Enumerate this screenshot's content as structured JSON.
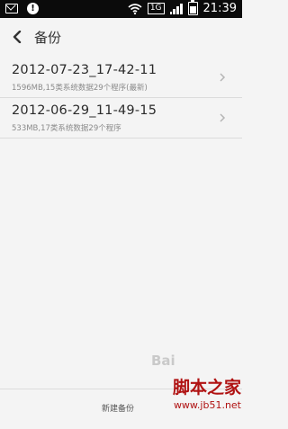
{
  "status_bar": {
    "time": "21:39",
    "sim_label": "1G",
    "icons": [
      "mail-icon",
      "alert-icon",
      "wifi-icon",
      "sim-badge",
      "signal-icon",
      "battery-icon"
    ]
  },
  "header": {
    "title": "备份",
    "back_icon": "chevron-left-icon"
  },
  "backups": [
    {
      "name": "2012-07-23_17-42-11",
      "details": "1596MB,15类系统数据29个程序(最新)"
    },
    {
      "name": "2012-06-29_11-49-15",
      "details": "533MB,17类系统数据29个程序"
    }
  ],
  "footer": {
    "new_backup_label": "新建备份"
  },
  "watermark": {
    "baidu_text": "Bai",
    "site_name": "脚本之家",
    "site_url": "www.jb51.net"
  },
  "colors": {
    "status_bar_bg": "#0b0b0b",
    "page_bg": "#f4f4f4",
    "title_text": "#333333",
    "secondary_text": "#8a8a8a",
    "watermark_red": "#b01212"
  }
}
